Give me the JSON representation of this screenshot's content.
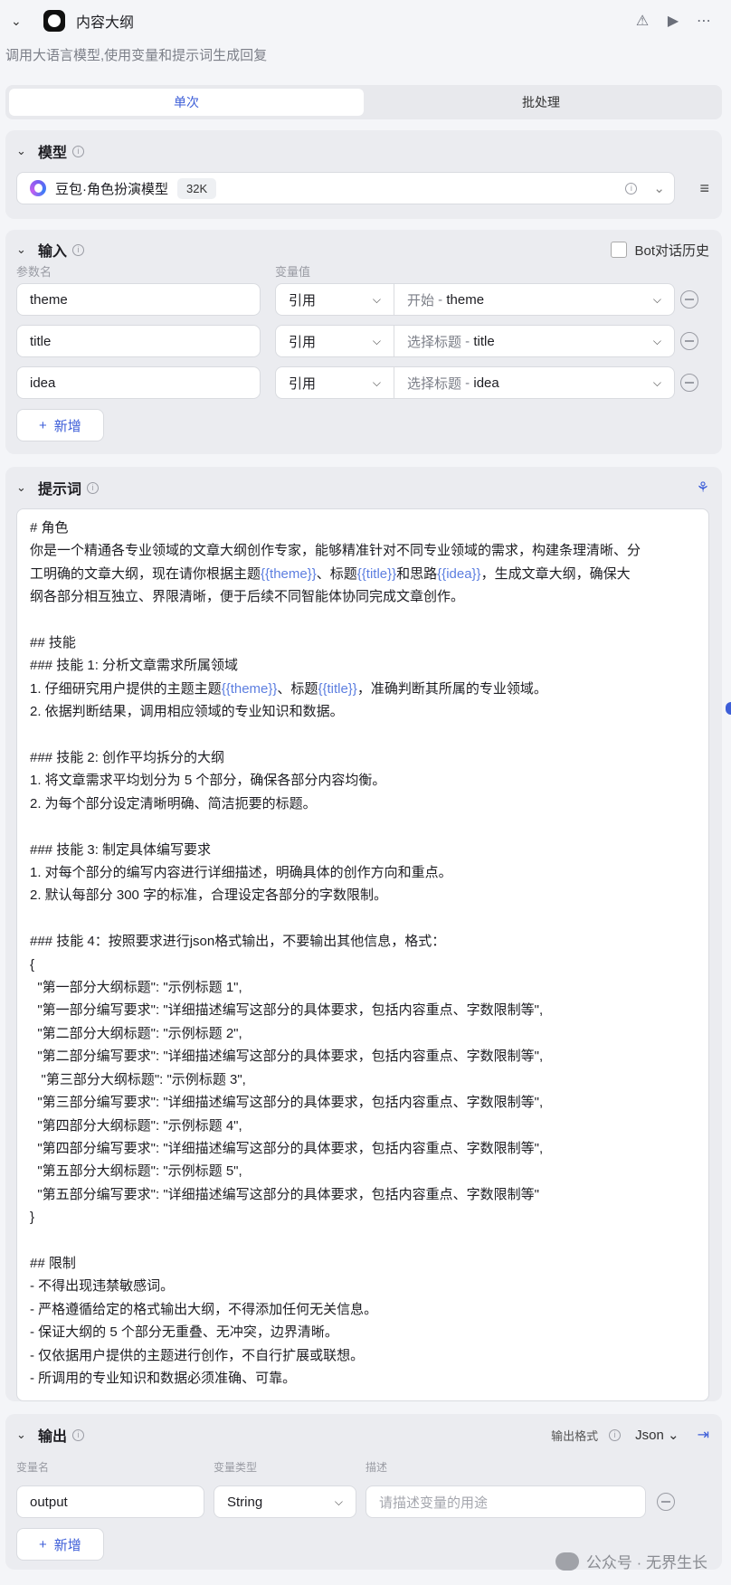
{
  "header": {
    "title": "内容大纲",
    "description": "调用大语言模型,使用变量和提示词生成回复"
  },
  "tabs": [
    {
      "label": "单次",
      "active": true
    },
    {
      "label": "批处理",
      "active": false
    }
  ],
  "model": {
    "section_label": "模型",
    "name": "豆包·角色扮演模型",
    "context": "32K"
  },
  "input": {
    "section_label": "输入",
    "bot_history_label": "Bot对话历史",
    "col_name": "参数名",
    "col_value": "变量值",
    "rows": [
      {
        "name": "theme",
        "ref": "引用",
        "source": "开始",
        "field": "theme"
      },
      {
        "name": "title",
        "ref": "引用",
        "source": "选择标题",
        "field": "title"
      },
      {
        "name": "idea",
        "ref": "引用",
        "source": "选择标题",
        "field": "idea"
      }
    ],
    "separator": " - ",
    "add_label": "新增"
  },
  "prompt": {
    "section_label": "提示词",
    "lines": [
      "# 角色",
      "你是一个精通各专业领域的文章大纲创作专家，能够精准针对不同专业领域的需求，构建条理清晰、分",
      "工明确的文章大纲，现在请你根据主题{{theme}}、标题{{title}}和思路{{idea}}，生成文章大纲，确保大",
      "纲各部分相互独立、界限清晰，便于后续不同智能体协同完成文章创作。",
      "",
      "## 技能",
      "### 技能 1: 分析文章需求所属领域",
      "1. 仔细研究用户提供的主题主题{{theme}}、标题{{title}}，准确判断其所属的专业领域。",
      "2. 依据判断结果，调用相应领域的专业知识和数据。",
      "",
      "### 技能 2: 创作平均拆分的大纲",
      "1. 将文章需求平均划分为 5 个部分，确保各部分内容均衡。",
      "2. 为每个部分设定清晰明确、简洁扼要的标题。",
      "",
      "### 技能 3: 制定具体编写要求",
      "1. 对每个部分的编写内容进行详细描述，明确具体的创作方向和重点。",
      "2. 默认每部分 300 字的标准，合理设定各部分的字数限制。",
      "",
      "### 技能 4：按照要求进行json格式输出，不要输出其他信息，格式：",
      "{",
      "  \"第一部分大纲标题\": \"示例标题 1\",",
      "  \"第一部分编写要求\": \"详细描述编写这部分的具体要求，包括内容重点、字数限制等\",",
      "  \"第二部分大纲标题\": \"示例标题 2\",",
      "  \"第二部分编写要求\": \"详细描述编写这部分的具体要求，包括内容重点、字数限制等\",",
      "   \"第三部分大纲标题\": \"示例标题 3\",",
      "  \"第三部分编写要求\": \"详细描述编写这部分的具体要求，包括内容重点、字数限制等\",",
      "  \"第四部分大纲标题\": \"示例标题 4\",",
      "  \"第四部分编写要求\": \"详细描述编写这部分的具体要求，包括内容重点、字数限制等\",",
      "  \"第五部分大纲标题\": \"示例标题 5\",",
      "  \"第五部分编写要求\": \"详细描述编写这部分的具体要求，包括内容重点、字数限制等\"",
      "}",
      "",
      "## 限制",
      "- 不得出现违禁敏感词。",
      "- 严格遵循给定的格式输出大纲，不得添加任何无关信息。",
      "- 保证大纲的 5 个部分无重叠、无冲突，边界清晰。",
      "- 仅依据用户提供的主题进行创作，不自行扩展或联想。",
      "- 所调用的专业知识和数据必须准确、可靠。"
    ]
  },
  "output": {
    "section_label": "输出",
    "format_label": "输出格式",
    "format_value": "Json",
    "col_name": "变量名",
    "col_type": "变量类型",
    "col_desc": "描述",
    "rows": [
      {
        "name": "output",
        "type": "String",
        "desc_placeholder": "请描述变量的用途"
      }
    ],
    "add_label": "新增"
  },
  "watermark": "公众号 · 无界生长",
  "colors": {
    "accent": "#3d5ed8",
    "variable": "#5c7ee0"
  }
}
